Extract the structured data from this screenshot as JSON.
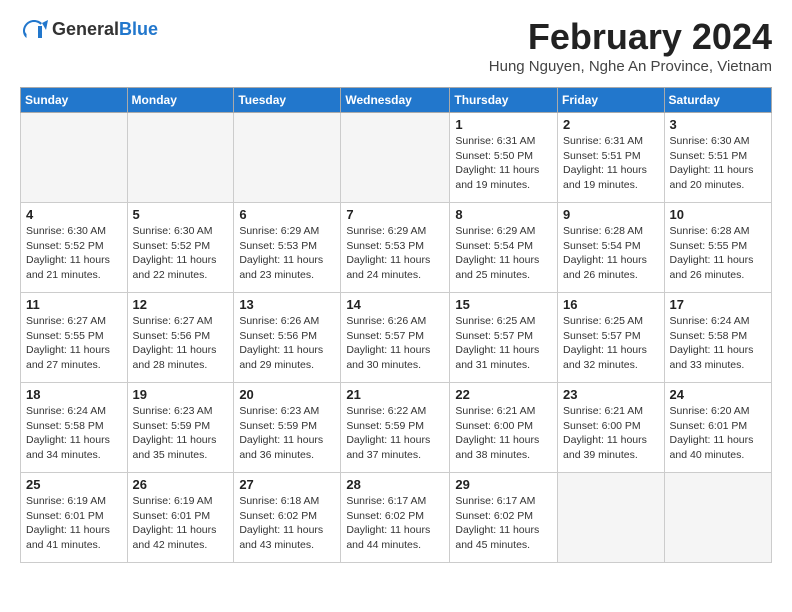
{
  "header": {
    "logo_general": "General",
    "logo_blue": "Blue",
    "month_title": "February 2024",
    "location": "Hung Nguyen, Nghe An Province, Vietnam"
  },
  "weekdays": [
    "Sunday",
    "Monday",
    "Tuesday",
    "Wednesday",
    "Thursday",
    "Friday",
    "Saturday"
  ],
  "weeks": [
    [
      {
        "day": "",
        "info": ""
      },
      {
        "day": "",
        "info": ""
      },
      {
        "day": "",
        "info": ""
      },
      {
        "day": "",
        "info": ""
      },
      {
        "day": "1",
        "info": "Sunrise: 6:31 AM\nSunset: 5:50 PM\nDaylight: 11 hours and 19 minutes."
      },
      {
        "day": "2",
        "info": "Sunrise: 6:31 AM\nSunset: 5:51 PM\nDaylight: 11 hours and 19 minutes."
      },
      {
        "day": "3",
        "info": "Sunrise: 6:30 AM\nSunset: 5:51 PM\nDaylight: 11 hours and 20 minutes."
      }
    ],
    [
      {
        "day": "4",
        "info": "Sunrise: 6:30 AM\nSunset: 5:52 PM\nDaylight: 11 hours and 21 minutes."
      },
      {
        "day": "5",
        "info": "Sunrise: 6:30 AM\nSunset: 5:52 PM\nDaylight: 11 hours and 22 minutes."
      },
      {
        "day": "6",
        "info": "Sunrise: 6:29 AM\nSunset: 5:53 PM\nDaylight: 11 hours and 23 minutes."
      },
      {
        "day": "7",
        "info": "Sunrise: 6:29 AM\nSunset: 5:53 PM\nDaylight: 11 hours and 24 minutes."
      },
      {
        "day": "8",
        "info": "Sunrise: 6:29 AM\nSunset: 5:54 PM\nDaylight: 11 hours and 25 minutes."
      },
      {
        "day": "9",
        "info": "Sunrise: 6:28 AM\nSunset: 5:54 PM\nDaylight: 11 hours and 26 minutes."
      },
      {
        "day": "10",
        "info": "Sunrise: 6:28 AM\nSunset: 5:55 PM\nDaylight: 11 hours and 26 minutes."
      }
    ],
    [
      {
        "day": "11",
        "info": "Sunrise: 6:27 AM\nSunset: 5:55 PM\nDaylight: 11 hours and 27 minutes."
      },
      {
        "day": "12",
        "info": "Sunrise: 6:27 AM\nSunset: 5:56 PM\nDaylight: 11 hours and 28 minutes."
      },
      {
        "day": "13",
        "info": "Sunrise: 6:26 AM\nSunset: 5:56 PM\nDaylight: 11 hours and 29 minutes."
      },
      {
        "day": "14",
        "info": "Sunrise: 6:26 AM\nSunset: 5:57 PM\nDaylight: 11 hours and 30 minutes."
      },
      {
        "day": "15",
        "info": "Sunrise: 6:25 AM\nSunset: 5:57 PM\nDaylight: 11 hours and 31 minutes."
      },
      {
        "day": "16",
        "info": "Sunrise: 6:25 AM\nSunset: 5:57 PM\nDaylight: 11 hours and 32 minutes."
      },
      {
        "day": "17",
        "info": "Sunrise: 6:24 AM\nSunset: 5:58 PM\nDaylight: 11 hours and 33 minutes."
      }
    ],
    [
      {
        "day": "18",
        "info": "Sunrise: 6:24 AM\nSunset: 5:58 PM\nDaylight: 11 hours and 34 minutes."
      },
      {
        "day": "19",
        "info": "Sunrise: 6:23 AM\nSunset: 5:59 PM\nDaylight: 11 hours and 35 minutes."
      },
      {
        "day": "20",
        "info": "Sunrise: 6:23 AM\nSunset: 5:59 PM\nDaylight: 11 hours and 36 minutes."
      },
      {
        "day": "21",
        "info": "Sunrise: 6:22 AM\nSunset: 5:59 PM\nDaylight: 11 hours and 37 minutes."
      },
      {
        "day": "22",
        "info": "Sunrise: 6:21 AM\nSunset: 6:00 PM\nDaylight: 11 hours and 38 minutes."
      },
      {
        "day": "23",
        "info": "Sunrise: 6:21 AM\nSunset: 6:00 PM\nDaylight: 11 hours and 39 minutes."
      },
      {
        "day": "24",
        "info": "Sunrise: 6:20 AM\nSunset: 6:01 PM\nDaylight: 11 hours and 40 minutes."
      }
    ],
    [
      {
        "day": "25",
        "info": "Sunrise: 6:19 AM\nSunset: 6:01 PM\nDaylight: 11 hours and 41 minutes."
      },
      {
        "day": "26",
        "info": "Sunrise: 6:19 AM\nSunset: 6:01 PM\nDaylight: 11 hours and 42 minutes."
      },
      {
        "day": "27",
        "info": "Sunrise: 6:18 AM\nSunset: 6:02 PM\nDaylight: 11 hours and 43 minutes."
      },
      {
        "day": "28",
        "info": "Sunrise: 6:17 AM\nSunset: 6:02 PM\nDaylight: 11 hours and 44 minutes."
      },
      {
        "day": "29",
        "info": "Sunrise: 6:17 AM\nSunset: 6:02 PM\nDaylight: 11 hours and 45 minutes."
      },
      {
        "day": "",
        "info": ""
      },
      {
        "day": "",
        "info": ""
      }
    ]
  ]
}
